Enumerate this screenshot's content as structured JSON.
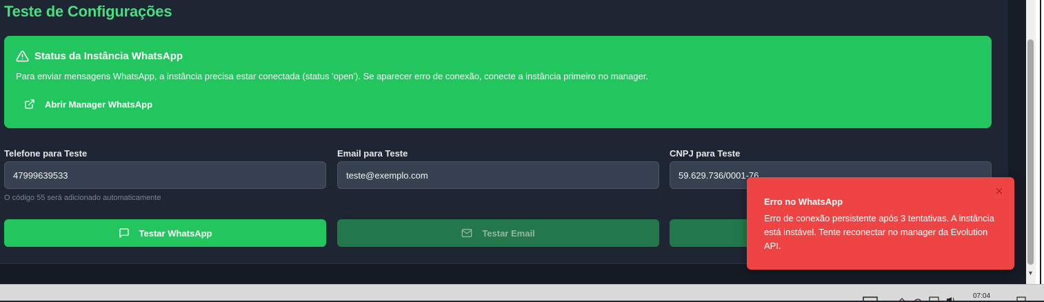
{
  "page": {
    "title": "Teste de Configurações"
  },
  "status_card": {
    "title": "Status da Instância WhatsApp",
    "description": "Para enviar mensagens WhatsApp, a instância precisa estar conectada (status 'open'). Se aparecer erro de conexão, conecte a instância primeiro no manager.",
    "link_label": "Abrir Manager WhatsApp"
  },
  "fields": {
    "phone": {
      "label": "Telefone para Teste",
      "value": "47999639533",
      "hint": "O código 55 será adicionado automaticamente"
    },
    "email": {
      "label": "Email para Teste",
      "value": "teste@exemplo.com"
    },
    "cnpj": {
      "label": "CNPJ para Teste",
      "value": "59.629.736/0001-76"
    }
  },
  "buttons": {
    "whatsapp": "Testar WhatsApp",
    "email": "Testar Email"
  },
  "toast": {
    "title": "Erro no WhatsApp",
    "message": "Erro de conexão persistente após 3 tentativas. A instância está instável. Tente reconectar no manager da Evolution API."
  },
  "taskbar": {
    "time": "07:04"
  },
  "colors": {
    "accent_green": "#22c55e",
    "title_green": "#4ade80",
    "error_red": "#ef4444",
    "background": "#1e2533"
  },
  "icons": [
    "alert-triangle-icon",
    "external-link-icon",
    "message-square-icon",
    "mail-icon",
    "close-icon"
  ]
}
